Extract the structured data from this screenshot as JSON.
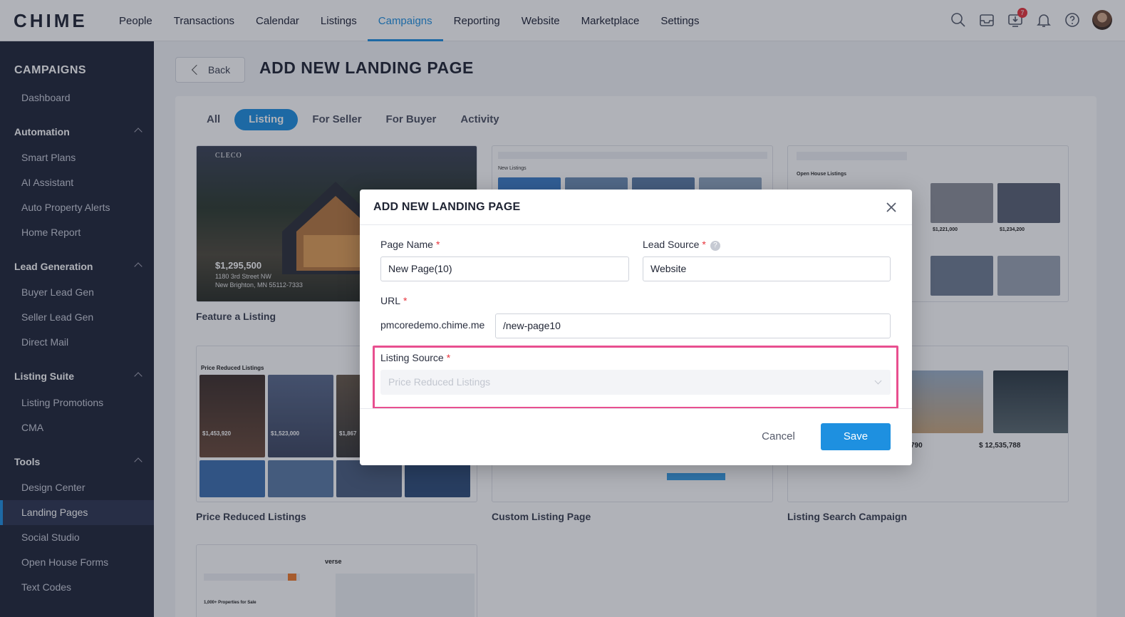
{
  "header": {
    "logo": "CHIME",
    "nav": [
      "People",
      "Transactions",
      "Calendar",
      "Listings",
      "Campaigns",
      "Reporting",
      "Website",
      "Marketplace",
      "Settings"
    ],
    "active_nav": "Campaigns",
    "icons": [
      "search-icon",
      "inbox-icon",
      "download-icon",
      "bell-icon",
      "help-icon",
      "avatar"
    ],
    "notification_count": "7"
  },
  "sidebar": {
    "title": "CAMPAIGNS",
    "dashboard": "Dashboard",
    "groups": [
      {
        "label": "Automation",
        "items": [
          "Smart Plans",
          "AI Assistant",
          "Auto Property Alerts",
          "Home Report"
        ]
      },
      {
        "label": "Lead Generation",
        "items": [
          "Buyer Lead Gen",
          "Seller Lead Gen",
          "Direct Mail"
        ]
      },
      {
        "label": "Listing Suite",
        "items": [
          "Listing Promotions",
          "CMA"
        ]
      },
      {
        "label": "Tools",
        "items": [
          "Design Center",
          "Landing Pages",
          "Social Studio",
          "Open House Forms",
          "Text Codes"
        ]
      }
    ],
    "active_item": "Landing Pages"
  },
  "main": {
    "back_label": "Back",
    "page_title": "ADD NEW LANDING PAGE",
    "tabs": [
      "All",
      "Listing",
      "For Seller",
      "For Buyer",
      "Activity"
    ],
    "active_tab": "Listing",
    "cards": [
      {
        "label": "Feature a Listing",
        "price": "$1,295,500",
        "address1": "1180 3rd Street NW",
        "address2": "New Brighton, MN 55112-7333",
        "brand": "CLECO"
      },
      {
        "label": "Custom Listing Page",
        "heading": "New Listings"
      },
      {
        "label": "Open House Listings",
        "heading": "Open House Listings",
        "price1": "$1,221,000",
        "price2": "$1,234,200"
      },
      {
        "label": "Price Reduced Listings",
        "heading": "Price Reduced Listings",
        "price1": "$1,453,920",
        "price2": "$1,523,000",
        "price3": "$1,867"
      },
      {
        "label": "Custom Listing Page"
      },
      {
        "label": "Listing Search Campaign",
        "price1": "790",
        "price2": "$ 12,535,788"
      },
      {
        "label": "",
        "brand": "verse",
        "heading": "1,000+ Properties for Sale"
      }
    ]
  },
  "modal": {
    "title": "ADD NEW LANDING PAGE",
    "page_name_label": "Page Name",
    "page_name_value": "New Page(10)",
    "lead_source_label": "Lead Source",
    "lead_source_value": "Website",
    "url_label": "URL",
    "url_prefix": "pmcoredemo.chime.me",
    "url_value": "/new-page10",
    "listing_source_label": "Listing Source",
    "listing_source_placeholder": "Price Reduced Listings",
    "required_mark": "*",
    "help_mark": "?",
    "cancel_label": "Cancel",
    "save_label": "Save"
  },
  "colors": {
    "accent": "#1e90e0",
    "sidebar_bg": "#1f2538",
    "highlight": "#e84f8f",
    "badge": "#e8333b"
  }
}
